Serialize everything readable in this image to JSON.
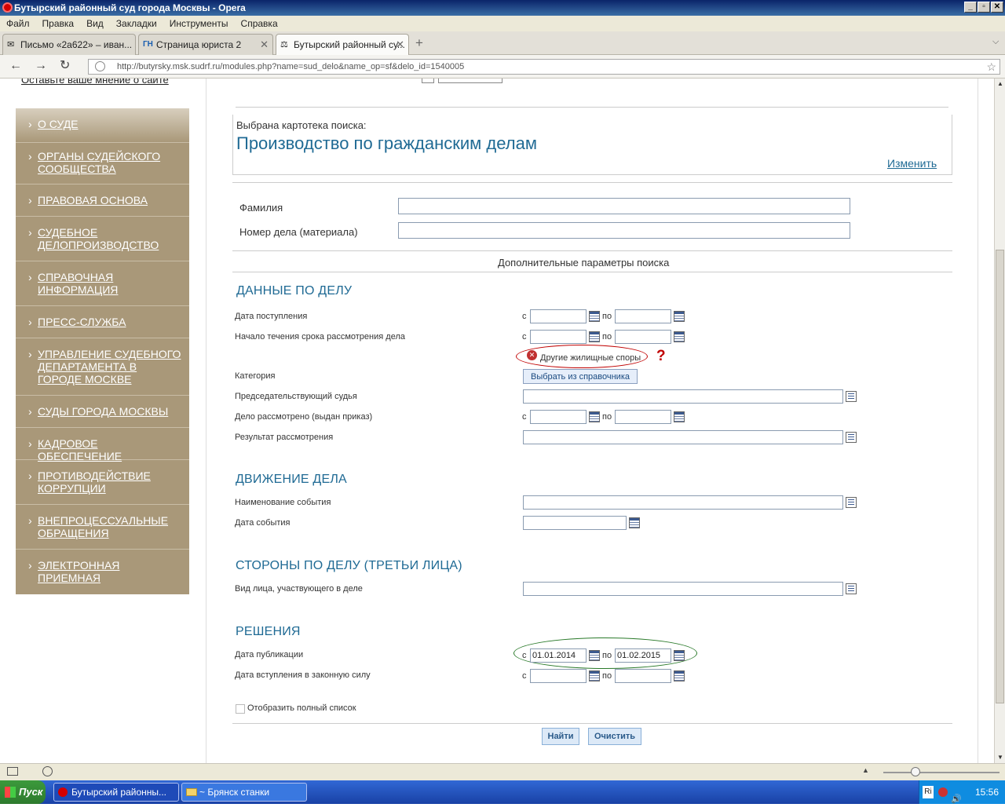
{
  "window": {
    "title": "Бутырский районный суд города Москвы - Opera"
  },
  "menu": [
    "Файл",
    "Правка",
    "Вид",
    "Закладки",
    "Инструменты",
    "Справка"
  ],
  "tabs": [
    {
      "label": "Письмо «2a622» – иван..."
    },
    {
      "label": "Страница юриста 2",
      "icon_text": "ГН"
    },
    {
      "label": "Бутырский районный су..."
    }
  ],
  "address": {
    "url": "http://butyrsky.msk.sudrf.ru/modules.php?name=sud_delo&name_op=sf&delo_id=1540005"
  },
  "sidebar": {
    "top_link": "Оставьте ваше мнение о сайте",
    "items": [
      "О суде",
      "Органы судейского сообщества",
      "Правовая основа",
      "Судебное делопроизводство",
      "Справочная информация",
      "Пресс-служба",
      "Управление судебного департамента в городе Москве",
      "Суды города Москвы",
      "Кадровое обеспечение",
      "Противодействие коррупции",
      "Внепроцессуальные обращения",
      "Электронная приемная"
    ],
    "arrow": "›"
  },
  "form": {
    "selected_label": "Выбрана картотека поиска:",
    "selected_value": "Производство по гражданским делам",
    "change_link": "Изменить",
    "surname_label": "Фамилия",
    "case_number_label": "Номер дела (материала)",
    "extra_params": "Дополнительные параметры поиска",
    "from": "с",
    "to": "по",
    "section_case": "Данные по делу",
    "date_received": "Дата поступления",
    "review_start": "Начало течения срока рассмотрения дела",
    "category_chip": "Другие жилищные споры",
    "question_mark": "?",
    "category_label": "Категория",
    "choose_button": "Выбрать из справочника",
    "judge_label": "Председательствующий судья",
    "reviewed_label": "Дело рассмотрено (выдан приказ)",
    "result_label": "Результат рассмотрения",
    "section_movement": "Движение дела",
    "event_name_label": "Наименование события",
    "event_date_label": "Дата события",
    "section_parties": "Стороны по делу (третьи лица)",
    "party_type_label": "Вид лица, участвующего в деле",
    "section_decisions": "Решения",
    "publication_label": "Дата публикации",
    "publication_from": "01.01.2014",
    "publication_to": "01.02.2015",
    "effective_label": "Дата вступления в законную силу",
    "full_list_label": "Отобразить полный список",
    "find_button": "Найти",
    "clear_button": "Очистить"
  },
  "taskbar": {
    "start": "Пуск",
    "tasks": [
      "Бутырский районны...",
      "~ Брянск станки"
    ],
    "lang": "Ri",
    "clock": "15:56"
  },
  "colors": {
    "sidebar": "#a99879",
    "section": "#1f6a94",
    "chip_ellipse": "#c00000",
    "publication_ellipse": "#2a7a2a"
  }
}
